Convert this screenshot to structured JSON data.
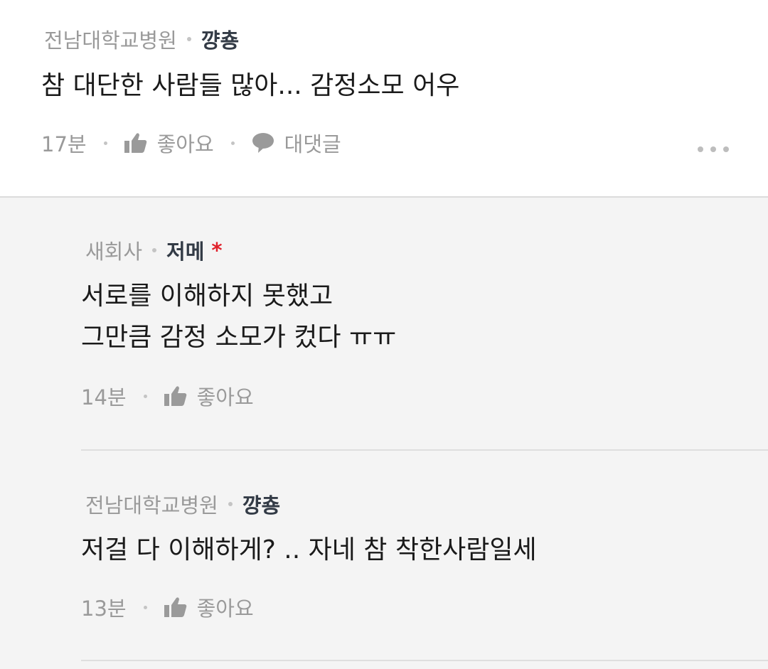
{
  "comment": {
    "company": "전남대학교병원",
    "nickname": "꺙춍",
    "text": "참 대단한 사람들 많아... 감정소모 어우",
    "time": "17분",
    "like_label": "좋아요",
    "reply_label": "대댓글",
    "more_icon": "more-dots-icon"
  },
  "replies": [
    {
      "company": "새회사",
      "nickname": "저메",
      "author_mark": "*",
      "lines": [
        "서로를 이해하지 못했고",
        "그만큼 감정 소모가 컸다 ㅠㅠ"
      ],
      "time": "14분",
      "like_label": "좋아요"
    },
    {
      "company": "전남대학교병원",
      "nickname": "꺙춍",
      "lines": [
        "저걸 다 이해하게? .. 자네 참 착한사람일세"
      ],
      "time": "13분",
      "like_label": "좋아요"
    }
  ],
  "colors": {
    "nickname": "#333b46",
    "meta": "#9a9a9a",
    "author_mark": "#e0202a",
    "reply_bg": "#f4f4f4"
  }
}
